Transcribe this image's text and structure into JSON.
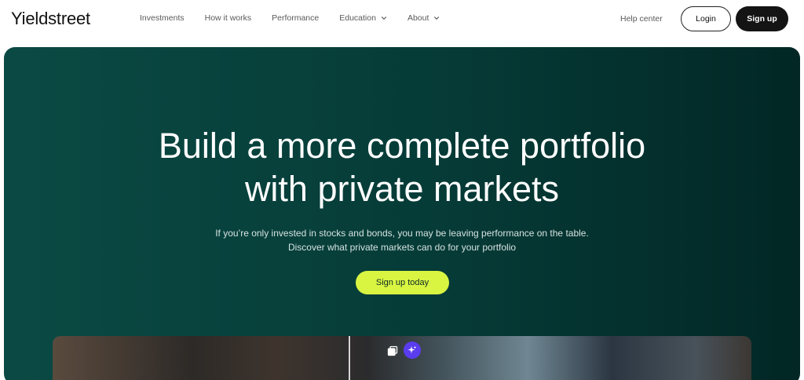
{
  "brand": {
    "logo_text": "Yieldstreet"
  },
  "nav": {
    "items": [
      {
        "label": "Investments",
        "has_dropdown": false
      },
      {
        "label": "How it works",
        "has_dropdown": false
      },
      {
        "label": "Performance",
        "has_dropdown": false
      },
      {
        "label": "Education",
        "has_dropdown": true
      },
      {
        "label": "About",
        "has_dropdown": true
      }
    ],
    "help_label": "Help center",
    "login_label": "Login",
    "signup_label": "Sign up"
  },
  "hero": {
    "title_line1": "Build a more complete portfolio",
    "title_line2": "with private markets",
    "subtitle_line1": "If you’re only invested in stocks and bonds, you may be leaving performance on the table.",
    "subtitle_line2": "Discover what private markets can do for your portfolio",
    "cta_label": "Sign up today"
  },
  "media": {
    "icons": [
      "copy-icon",
      "sparkle-icon"
    ]
  },
  "colors": {
    "hero_bg": "#0b4a44",
    "cta_bg": "#d9f542",
    "signup_bg": "#141414",
    "sparkle_bg": "#5b3df0"
  }
}
